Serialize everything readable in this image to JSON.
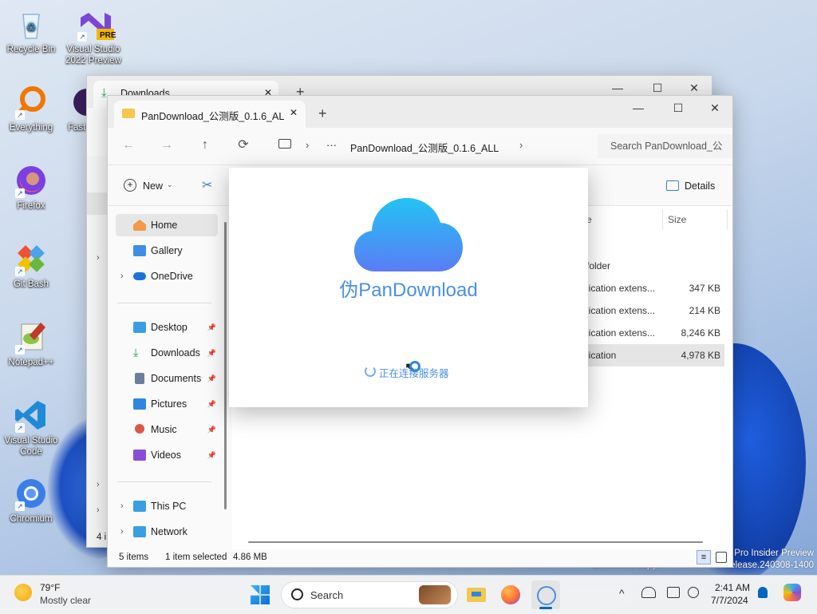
{
  "desktop": {
    "icons": [
      {
        "label": "Recycle Bin"
      },
      {
        "label": "Visual Studio 2022 Preview",
        "badge": "PRE"
      },
      {
        "label": "Everything"
      },
      {
        "label": "Fast"
      },
      {
        "label": "Firefox"
      },
      {
        "label": "Git Bash"
      },
      {
        "label": "Notepad++"
      },
      {
        "label": "Visual Studio Code"
      },
      {
        "label": "Chromium"
      }
    ],
    "watermark": {
      "line1": "Pro Insider Preview",
      "line2": "Evaluation copy.",
      "line3": "elease.240308-1400"
    }
  },
  "back_window": {
    "tab_title": "Downloads",
    "new_tab": "+",
    "status_items": "4 i"
  },
  "explorer": {
    "tab_title": "PanDownload_公测版_0.1.6_AL",
    "tab_close": "✕",
    "new_tab": "+",
    "caption": {
      "minimize": "—",
      "maximize": "☐",
      "close": "✕"
    },
    "nav": {
      "back": "←",
      "forward": "→",
      "up": "↑",
      "refresh": "⟳"
    },
    "breadcrumb": {
      "more": "···",
      "folder": "PanDownload_公测版_0.1.6_ALL"
    },
    "search_placeholder": "Search PanDownload_公",
    "toolbar": {
      "new_label": "New",
      "details_label": "Details"
    },
    "sidebar": {
      "items": [
        {
          "label": "Home"
        },
        {
          "label": "Gallery"
        },
        {
          "label": "OneDrive"
        },
        {
          "label": "Desktop"
        },
        {
          "label": "Downloads"
        },
        {
          "label": "Documents"
        },
        {
          "label": "Pictures"
        },
        {
          "label": "Music"
        },
        {
          "label": "Videos"
        },
        {
          "label": "This PC"
        },
        {
          "label": "Network"
        }
      ]
    },
    "columns": {
      "type": "e",
      "size": "Size"
    },
    "rows": [
      {
        "type": "folder",
        "size": ""
      },
      {
        "type": "lication extens...",
        "size": "347 KB"
      },
      {
        "type": "lication extens...",
        "size": "214 KB"
      },
      {
        "type": "lication extens...",
        "size": "8,246 KB"
      },
      {
        "type": "lication",
        "size": "4,978 KB"
      }
    ],
    "status": {
      "items": "5 items",
      "selected": "1 item selected",
      "size": "4.86 MB"
    }
  },
  "dialog": {
    "app_name": "伪PanDownload",
    "loading_text": "正在连接服务器"
  },
  "taskbar": {
    "weather": {
      "temp": "79°F",
      "desc": "Mostly clear"
    },
    "search_label": "Search",
    "clock": {
      "time": "2:41 AM",
      "date": "7/7/2024"
    },
    "chevron": "^"
  },
  "colors": {
    "accent": "#0067c0",
    "cloud_top": "#22c3f3",
    "cloud_bottom": "#5b7cf5",
    "dialog_text": "#4a90e2"
  }
}
